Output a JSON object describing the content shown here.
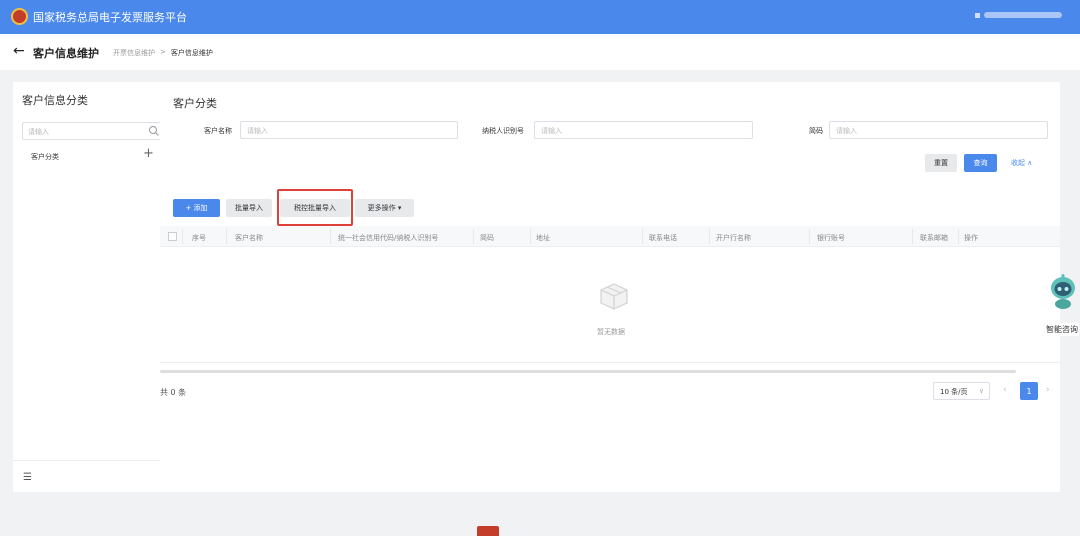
{
  "header": {
    "title": "国家税务总局电子发票服务平台"
  },
  "page": {
    "back_icon": "←",
    "title": "客户信息维护",
    "breadcrumb": [
      "开票信息维护",
      "客户信息维护"
    ],
    "breadcrumb_sep": ">"
  },
  "sidebar": {
    "title": "客户信息分类",
    "search_placeholder": "请输入",
    "node": "客户分类",
    "add_icon": "+",
    "menu_icon": "☰"
  },
  "main": {
    "title": "客户分类",
    "filters": [
      {
        "label": "客户名称",
        "placeholder": "请输入"
      },
      {
        "label": "纳税人识别号",
        "placeholder": "请输入"
      },
      {
        "label": "简码",
        "placeholder": "请输入"
      }
    ],
    "reset_label": "重置",
    "query_label": "查询",
    "collapse_label": "收起 ∧",
    "toolbar": {
      "add_label": "+ 添加",
      "batch_import_label": "批量导入",
      "tax_batch_import_label": "税控批量导入",
      "more_label": "更多操作 ▾"
    },
    "columns": [
      "序号",
      "客户名称",
      "统一社会信用代码/纳税人识别号",
      "简码",
      "地址",
      "联系电话",
      "开户行名称",
      "银行账号",
      "联系邮箱",
      "操作"
    ],
    "empty_text": "暂无数据",
    "total_text": "共 0 条",
    "page_size": "10 条/页",
    "page_size_arrow": "∨",
    "prev_label": "‹",
    "current_page": "1",
    "next_label": "›"
  },
  "assistant": {
    "label": "智能咨询"
  },
  "colors": {
    "primary": "#4b88ec",
    "highlight": "#e0403a"
  }
}
